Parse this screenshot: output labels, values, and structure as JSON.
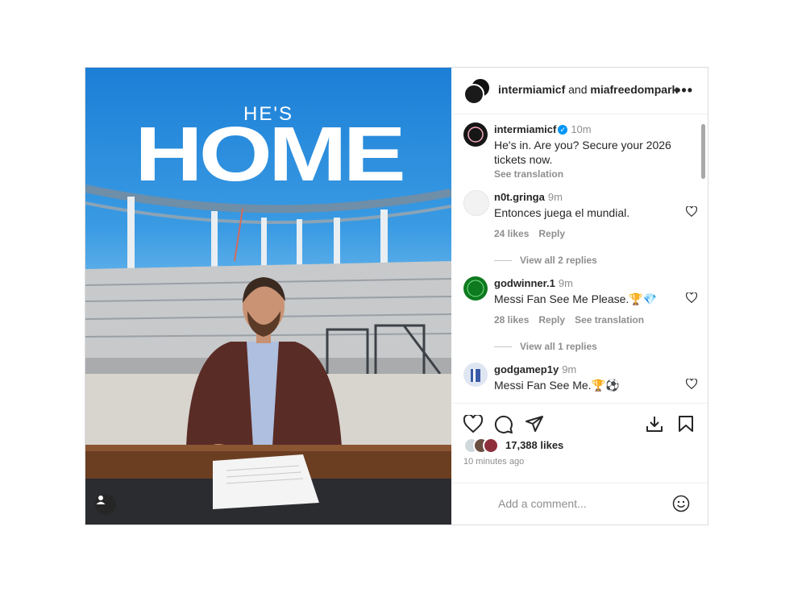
{
  "media": {
    "headline_small": "HE'S",
    "headline_big": "HOME"
  },
  "header": {
    "user1": "intermiamicf",
    "connector": "and",
    "user2": "miafreedompark",
    "more_icon": "more-horizontal-icon"
  },
  "caption": {
    "username": "intermiamicf",
    "time": "10m",
    "text": "He's in. Are you? Secure your 2026 tickets now.",
    "see_translation": "See translation"
  },
  "comments": [
    {
      "username": "n0t.gringa",
      "time": "9m",
      "text": "Entonces juega el mundial.",
      "likes": "24 likes",
      "reply": "Reply",
      "view_replies": "View all 2 replies"
    },
    {
      "username": "godwinner.1",
      "time": "9m",
      "text": "Messi Fan See Me Please.🏆💎",
      "likes": "28 likes",
      "reply": "Reply",
      "see_translation": "See translation",
      "view_replies": "View all 1 replies"
    },
    {
      "username": "godgamep1y",
      "time": "9m",
      "text": "Messi Fan See Me.🏆⚽"
    }
  ],
  "actions": {
    "like_icon": "heart-icon",
    "comment_icon": "comment-icon",
    "share_icon": "paper-plane-icon",
    "download_icon": "download-icon",
    "save_icon": "bookmark-icon"
  },
  "likes": "17,388 likes",
  "posted": "10 minutes ago",
  "add_comment_placeholder": "Add a comment...",
  "colors": {
    "sky": "#1c7fd6",
    "verified": "#0095f6",
    "text": "#262626",
    "muted": "#8e8e8e",
    "border": "#dbdbdb"
  }
}
